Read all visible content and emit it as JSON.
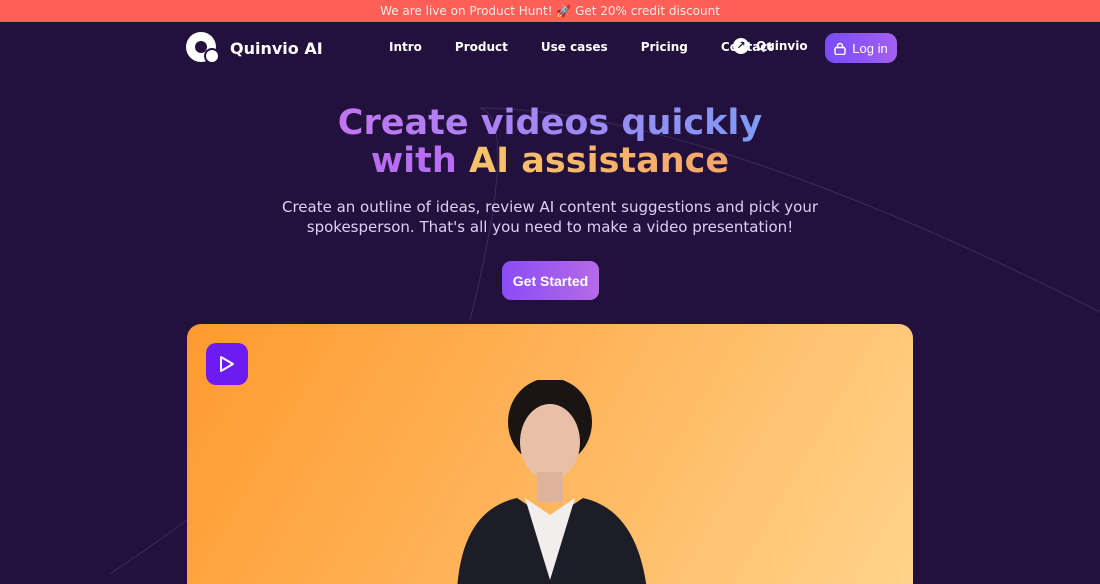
{
  "banner": {
    "text": "We are live on Product Hunt! 🚀 Get 20% credit discount"
  },
  "nav": {
    "brand": "Quinvio AI",
    "links": [
      "Intro",
      "Product",
      "Use cases",
      "Pricing",
      "Contact"
    ],
    "quinvio_label": "Quinvio",
    "login_label": "Log in"
  },
  "hero": {
    "title_line1": "Create videos quickly",
    "title_with": "with",
    "title_ai": "AI assistance",
    "subtitle_line1": "Create an outline of ideas, review AI content suggestions and pick your",
    "subtitle_line2": "spokesperson. That's all you need to make a video presentation!",
    "cta_label": "Get Started"
  },
  "colors": {
    "background": "#22113d",
    "banner": "#ff5f56",
    "accent": "#7a4bff"
  }
}
